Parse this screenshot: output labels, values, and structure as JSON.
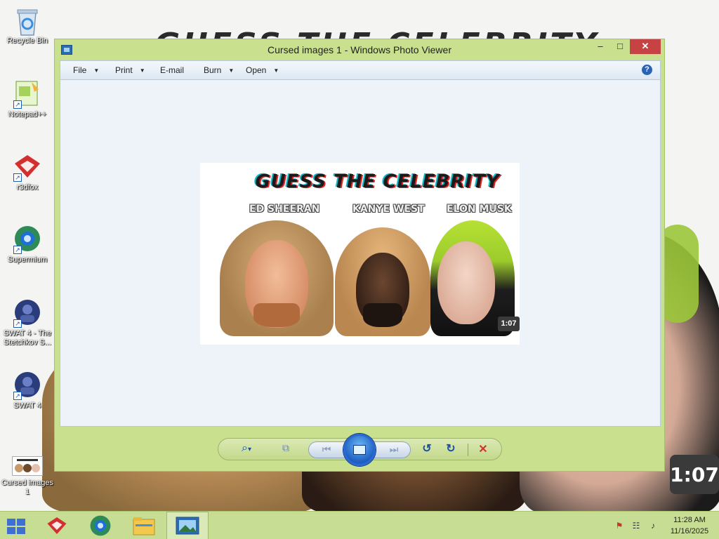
{
  "desktop": {
    "wallpaper_title": "GUESS THE CELEBRITY",
    "wallpaper_timestamp": "1:07",
    "icons": [
      {
        "label": "Recycle Bin"
      },
      {
        "label": "Notepad++"
      },
      {
        "label": "r3dfox"
      },
      {
        "label": "Supermium"
      },
      {
        "label": "SWAT 4 - The Stetchkov S..."
      },
      {
        "label": "SWAT 4"
      },
      {
        "label": "Cursed images 1"
      }
    ]
  },
  "window": {
    "title": "Cursed images 1 - Windows Photo Viewer",
    "controls": {
      "minimize": "–",
      "maximize": "□",
      "close": "✕"
    },
    "menu": {
      "file": "File",
      "print": "Print",
      "email": "E-mail",
      "burn": "Burn",
      "open": "Open",
      "help": "?"
    },
    "photo": {
      "title": "GUESS THE CELEBRITY",
      "names": [
        "ED SHEERAN",
        "KANYE WEST",
        "ELON MUSK"
      ],
      "timestamp": "1:07"
    },
    "controlbar": {
      "zoom": "⌕",
      "zoom_caret": "▾",
      "actual_size": "⧉",
      "previous": "⏮",
      "next": "⏭",
      "rotate_ccw": "↺",
      "rotate_cw": "↻",
      "delete": "✕"
    }
  },
  "taskbar": {
    "apps": [
      "Start",
      "r3dfox",
      "Supermium",
      "File Explorer",
      "Windows Photo Viewer"
    ],
    "tray": {
      "flag": "⚑",
      "network": "☷",
      "volume": "♪"
    },
    "time": "11:28 AM",
    "date": "11/16/2025"
  },
  "colors": {
    "window_frame": "#c9e08f",
    "viewer_bg": "#eef3fa",
    "close_button": "#c74343",
    "taskbar": "#c7dd93",
    "accent_blue": "#1f4fa0"
  }
}
